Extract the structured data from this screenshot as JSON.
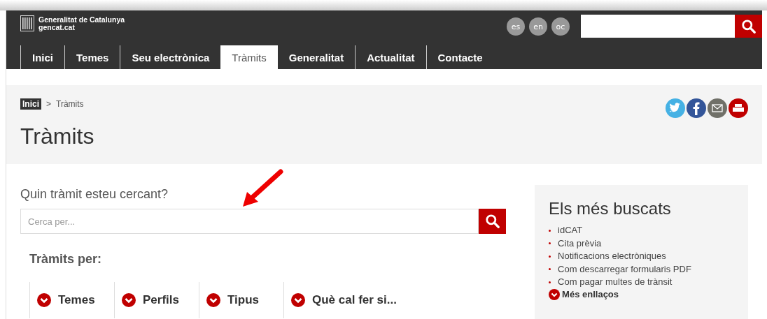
{
  "header": {
    "logo_lines": [
      "Generalitat de Catalunya",
      "gencat.cat"
    ],
    "languages": [
      "es",
      "en",
      "oc"
    ]
  },
  "nav": [
    {
      "label": "Inici",
      "selected": false
    },
    {
      "label": "Temes",
      "selected": false
    },
    {
      "label": "Seu electrònica",
      "selected": false
    },
    {
      "label": "Tràmits",
      "selected": true
    },
    {
      "label": "Generalitat",
      "selected": false
    },
    {
      "label": "Actualitat",
      "selected": false
    },
    {
      "label": "Contacte",
      "selected": false
    }
  ],
  "breadcrumb": {
    "links": [
      "Inici"
    ],
    "separator": ">",
    "current": "Tràmits"
  },
  "page_title": "Tràmits",
  "search_section": {
    "heading": "Quin tràmit esteu cercant?",
    "placeholder": "Cerca per..."
  },
  "filters": {
    "heading": "Tràmits per:",
    "items": [
      "Temes",
      "Perfils",
      "Tipus",
      "Què cal fer si..."
    ]
  },
  "sidebar": {
    "title": "Els més buscats",
    "links": [
      "idCAT",
      "Cita prèvia",
      "Notificacions electròniques",
      "Com descarregar formularis PDF",
      "Com pagar multes de trànsit"
    ],
    "more": "Més enllaços"
  }
}
